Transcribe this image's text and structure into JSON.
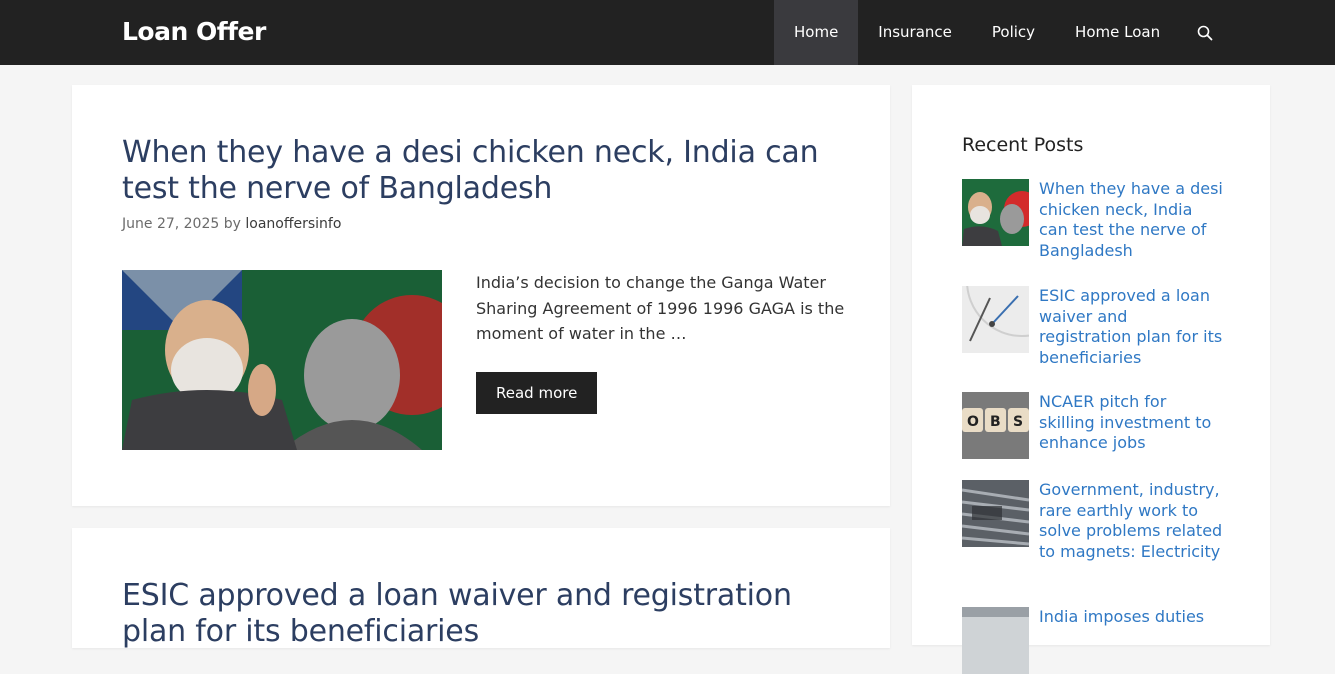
{
  "header": {
    "site_title": "Loan Offer",
    "nav": [
      {
        "label": "Home",
        "active": true
      },
      {
        "label": "Insurance",
        "active": false
      },
      {
        "label": "Policy",
        "active": false
      },
      {
        "label": "Home Loan",
        "active": false
      }
    ],
    "search_icon": "search-icon"
  },
  "posts": [
    {
      "title": "When they have a desi chicken neck, India can test the nerve of Bangladesh",
      "date": "June 27, 2025",
      "by": "by",
      "author": "loanoffersinfo",
      "excerpt": "India’s decision to change the Ganga Water Sharing Agreement of 1996 1996 GAGA is the moment of water in the …",
      "read_more": "Read more"
    },
    {
      "title": "ESIC approved a loan waiver and registration plan for its beneficiaries"
    }
  ],
  "sidebar": {
    "widget_title": "Recent Posts",
    "items": [
      {
        "title": "When they have a desi chicken neck, India can test the nerve of Bangladesh"
      },
      {
        "title": "ESIC approved a loan waiver and registration plan for its beneficiaries"
      },
      {
        "title": "NCAER pitch for skilling investment to enhance jobs"
      },
      {
        "title": "Government, industry, rare earthly work to solve problems related to magnets: Electricity"
      },
      {
        "title": "India imposes duties"
      }
    ]
  },
  "colors": {
    "header_bg": "#222222",
    "nav_active_bg": "#3a3a3e",
    "title_color": "#2c3e61",
    "link_color": "#2f78c4",
    "page_bg": "#f5f5f5"
  }
}
